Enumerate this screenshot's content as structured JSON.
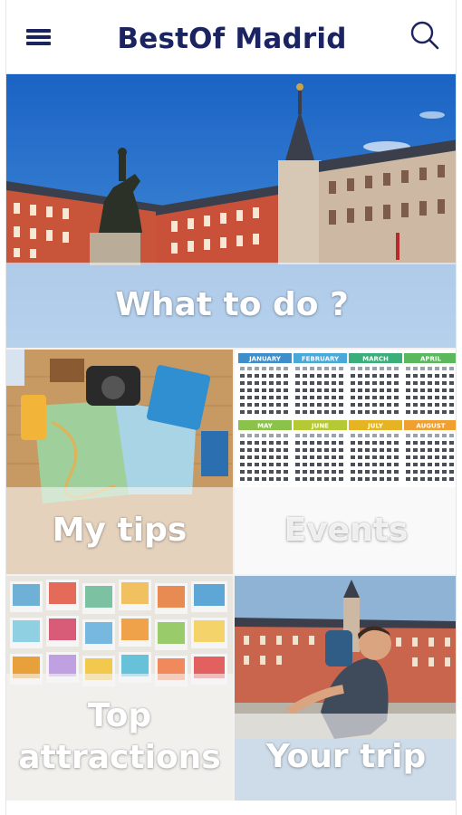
{
  "header": {
    "title": "BestOf Madrid",
    "menu_icon": "hamburger-menu-icon",
    "search_icon": "search-icon"
  },
  "tiles": [
    {
      "label": "What to do ?",
      "image": "plaza-mayor-photo"
    },
    {
      "label": "My tips",
      "image": "travel-items-flatlay"
    },
    {
      "label": "Events",
      "image": "calendar-months-image"
    },
    {
      "label": "Top attractions",
      "image": "landmark-polaroids-image"
    },
    {
      "label": "Your trip",
      "image": "traveler-selfie-plaza-photo"
    }
  ],
  "calendar": {
    "months": [
      "JANUARY",
      "FEBRUARY",
      "MARCH",
      "APRIL",
      "MAY",
      "JUNE",
      "JULY",
      "AUGUST"
    ],
    "colors": [
      "#3d8ec9",
      "#49a9d9",
      "#3aae7b",
      "#5cb85c",
      "#8bc34a",
      "#b5c934",
      "#e6b422",
      "#f0a030"
    ]
  },
  "colors": {
    "brand": "#1b2461",
    "label_band": "#f5f5f5"
  }
}
